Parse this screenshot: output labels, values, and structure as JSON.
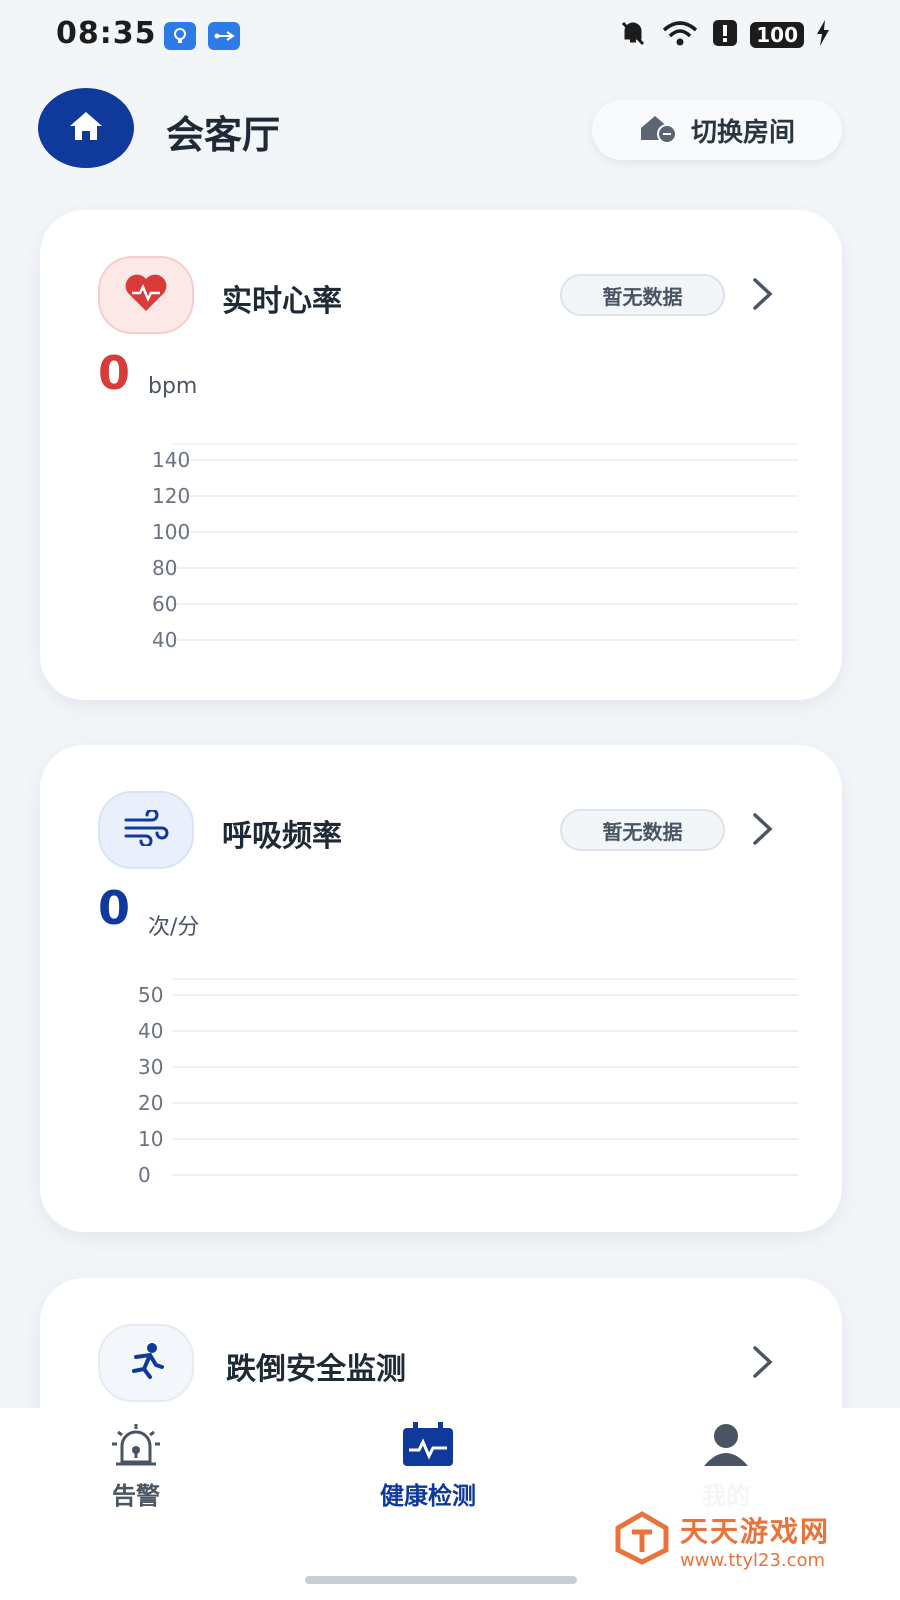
{
  "status_bar": {
    "time": "08:35",
    "battery": "100"
  },
  "header": {
    "room_name": "会客厅",
    "switch_room_label": "切换房间"
  },
  "cards": [
    {
      "title": "实时心率",
      "badge": "暂无数据",
      "value": "0",
      "unit": "bpm",
      "color": "#d93a3a"
    },
    {
      "title": "呼吸频率",
      "badge": "暂无数据",
      "value": "0",
      "unit": "次/分",
      "color": "#0f3a9c"
    },
    {
      "title": "跌倒安全监测"
    }
  ],
  "chart_data": [
    {
      "type": "line",
      "series": [],
      "yticks": [
        "140",
        "120",
        "100",
        "80",
        "60",
        "40"
      ],
      "ylim": [
        40,
        140
      ],
      "grid": true
    },
    {
      "type": "line",
      "series": [],
      "yticks": [
        "50",
        "40",
        "30",
        "20",
        "10",
        "0"
      ],
      "ylim": [
        0,
        50
      ],
      "grid": true
    }
  ],
  "bottom_nav": {
    "items": [
      {
        "label": "告警",
        "icon": "alarm-icon",
        "active": false
      },
      {
        "label": "健康检测",
        "icon": "health-monitor-icon",
        "active": true
      },
      {
        "label": "我的",
        "icon": "user-icon",
        "active": false
      }
    ]
  },
  "watermark": {
    "title": "天天游戏网",
    "url": "www.ttyl23.com"
  }
}
